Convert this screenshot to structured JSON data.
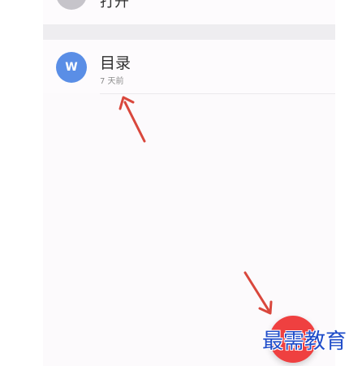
{
  "top_item": {
    "label": "打开",
    "icon": "folder-icon"
  },
  "file": {
    "name": "目录",
    "time": "7 天前",
    "icon_letter": "W",
    "icon": "word-document-icon",
    "icon_color": "#5a8ee6"
  },
  "fab": {
    "icon": "add-icon",
    "label": "+",
    "color": "#ef4040"
  },
  "watermark": {
    "text": "最需教育"
  },
  "annotations": {
    "arrow_color": "#d9473c"
  }
}
